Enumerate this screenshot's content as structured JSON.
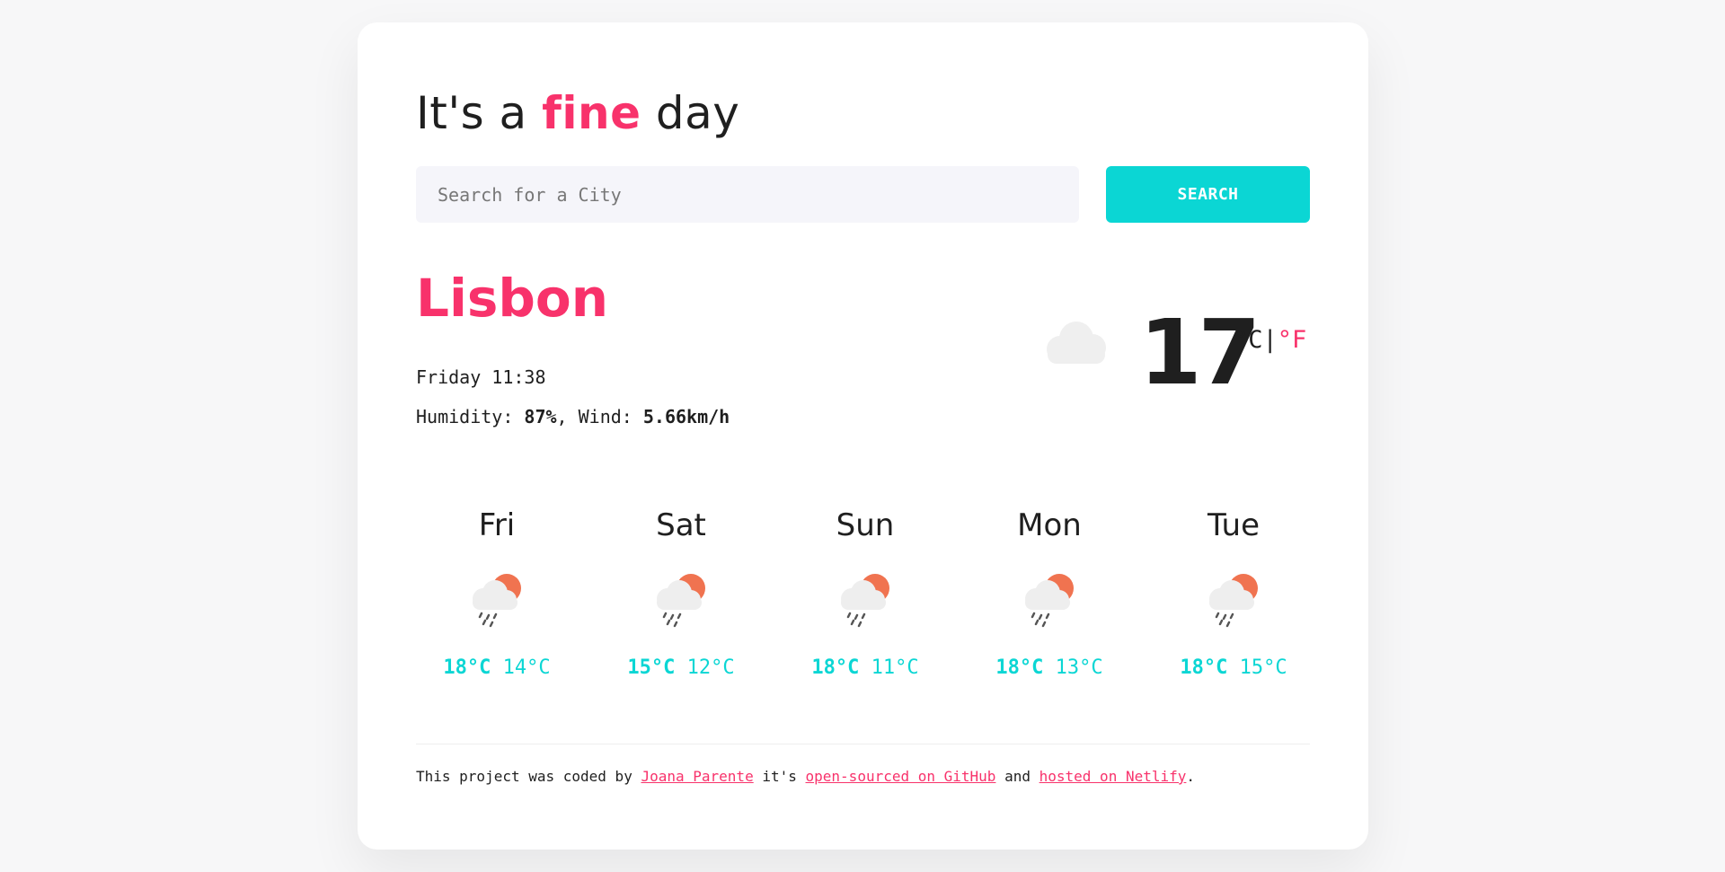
{
  "header": {
    "title_prefix": "It's a",
    "title_accent": "fine",
    "title_suffix": "day"
  },
  "search": {
    "placeholder": "Search for a City",
    "value": "",
    "button_label": "SEARCH"
  },
  "current": {
    "city": "Lisbon",
    "datetime": "Friday 11:38",
    "humidity_label": "Humidity:",
    "humidity_value": "87%",
    "wind_label": ", Wind:",
    "wind_value": "5.66km/h",
    "icon": "cloud-icon",
    "temperature": "17",
    "unit_c": "°C",
    "unit_separator": "|",
    "unit_f": "°F"
  },
  "forecast": [
    {
      "day": "Fri",
      "icon": "rain-sun-icon",
      "max": "18°C",
      "min": "14°C"
    },
    {
      "day": "Sat",
      "icon": "rain-sun-icon",
      "max": "15°C",
      "min": "12°C"
    },
    {
      "day": "Sun",
      "icon": "rain-sun-icon",
      "max": "18°C",
      "min": "11°C"
    },
    {
      "day": "Mon",
      "icon": "rain-sun-icon",
      "max": "18°C",
      "min": "13°C"
    },
    {
      "day": "Tue",
      "icon": "rain-sun-icon",
      "max": "18°C",
      "min": "15°C"
    }
  ],
  "footer": {
    "text_1": "This project was coded by",
    "link_author": "Joana Parente",
    "text_2": "it's",
    "link_github": "open-sourced on GitHub",
    "text_3": "and",
    "link_netlify": "hosted on Netlify",
    "text_4": "."
  },
  "colors": {
    "accent": "#f8326b",
    "teal": "#0bd6d4",
    "text": "#1f1f1f",
    "background": "#f7f7f8",
    "input_bg": "#f5f5fa"
  }
}
